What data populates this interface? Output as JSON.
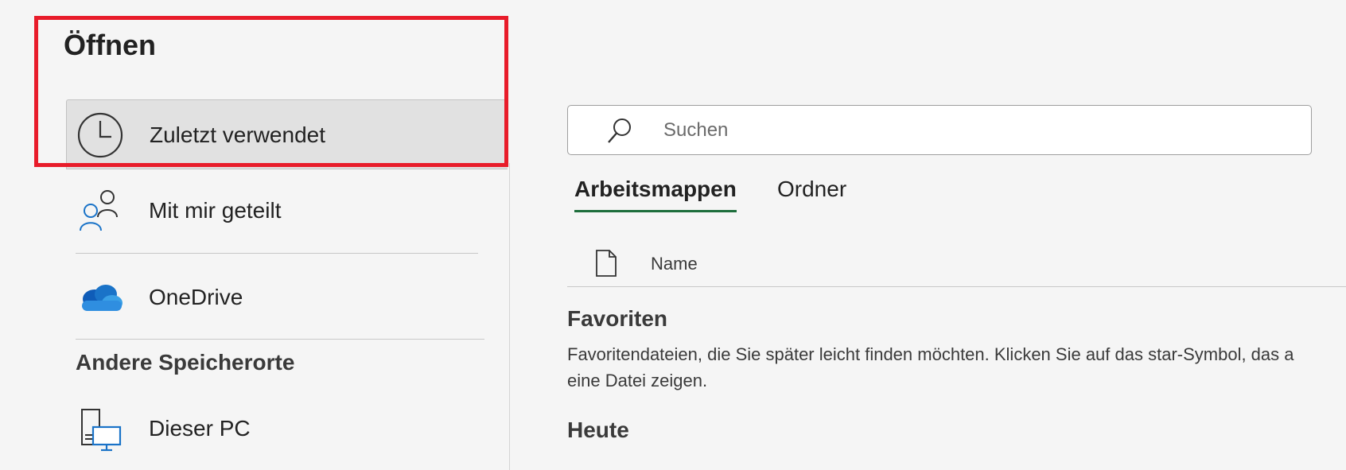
{
  "page_title": "Öffnen",
  "nav": {
    "recent": {
      "label": "Zuletzt verwendet",
      "icon": "clock-icon"
    },
    "shared": {
      "label": "Mit mir geteilt",
      "icon": "people-icon"
    },
    "onedrive": {
      "label": "OneDrive",
      "icon": "onedrive-cloud-icon"
    },
    "other_locations_heading": "Andere Speicherorte",
    "this_pc": {
      "label": "Dieser PC",
      "icon": "computer-icon"
    }
  },
  "search": {
    "placeholder": "Suchen",
    "value": "",
    "icon": "search-icon"
  },
  "tabs": [
    {
      "label": "Arbeitsmappen",
      "active": true
    },
    {
      "label": "Ordner",
      "active": false
    }
  ],
  "file_list": {
    "column_name": "Name",
    "column_icon": "document-icon"
  },
  "favorites": {
    "title": "Favoriten",
    "description_line1": "Favoritendateien, die Sie später leicht finden möchten. Klicken Sie auf das star-Symbol, das a",
    "description_line2": "eine Datei zeigen."
  },
  "today": {
    "title": "Heute"
  },
  "colors": {
    "accent_green": "#1e6e3c",
    "highlight_red": "#e81c2a",
    "selected_bg": "#e1e1e1",
    "page_bg": "#f5f5f5",
    "onedrive_blue": "#1a73c8"
  }
}
